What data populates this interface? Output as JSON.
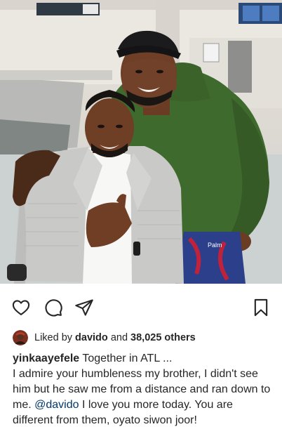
{
  "post": {
    "liked_by_prefix": "Liked by",
    "liked_by_user": "davido",
    "liked_by_and": "and",
    "liked_count": "38,025 others",
    "caption_user": "yinkaayefele",
    "caption_line1": "Together in ATL ...",
    "caption_body1": "I admire your humbleness my brother, I didn't see him but he saw me from a distance and ran down to me.",
    "caption_mention": "@davido",
    "caption_body2": "I love you more today. You are different from them, oyato siwon joor!"
  },
  "photo": {
    "hoodie_text": "Palm"
  },
  "colors": {
    "text": "#262626",
    "mention": "#00376b",
    "hoodie": "#3f6a2e",
    "blazer": "#c9c9c7"
  },
  "icons": [
    "heart-icon",
    "comment-icon",
    "share-icon",
    "bookmark-icon"
  ]
}
